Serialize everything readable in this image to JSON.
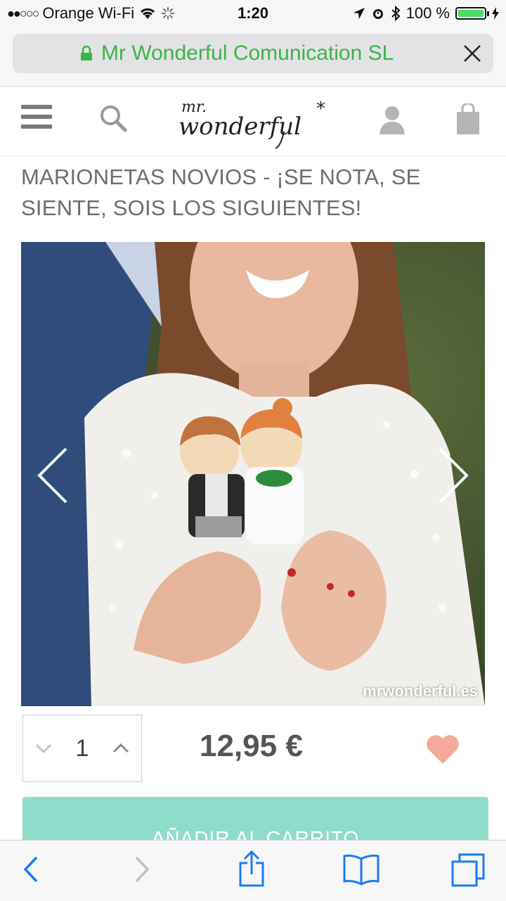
{
  "status_bar": {
    "carrier": "Orange Wi-Fi",
    "time": "1:20",
    "battery": "100 %",
    "battery_level": 1.0
  },
  "url_bar": {
    "site_name": "Mr Wonderful Comunication SL",
    "site_color": "#3bb34a"
  },
  "header": {
    "logo_text": "mr. wonderful*"
  },
  "product": {
    "title": "MARIONETAS NOVIOS - ¡SE NOTA, SE SIENTE, SOIS LOS SIGUIENTES!",
    "image_watermark": "mrwonderful.es",
    "quantity": "1",
    "price": "12,95 €",
    "add_to_cart_label": "AÑADIR AL CARRITO",
    "accent_color": "#8fdccb",
    "heart_color": "#f5a99b"
  },
  "toolbar": {
    "icons": [
      "back-icon",
      "forward-icon",
      "share-icon",
      "bookmarks-icon",
      "tabs-icon"
    ]
  }
}
